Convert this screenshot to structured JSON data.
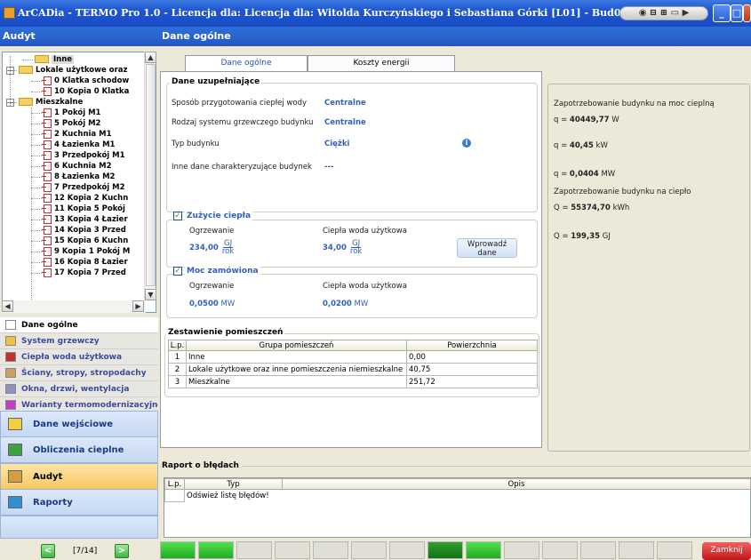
{
  "window": {
    "title": "ArCADia - TERMO Pro 1.0 - Licencja dla: Licencja dla: Witolda Kurczyńskiego i Sebastiana Górki [L01] - Bud0"
  },
  "left_panel": {
    "header": "Audyt",
    "tree": [
      {
        "label": "Inne",
        "kind": "folder",
        "depth": 1
      },
      {
        "label": "Lokale użytkowe oraz",
        "kind": "folder",
        "depth": 0
      },
      {
        "label": "0 Klatka schodow",
        "kind": "doc",
        "depth": 1
      },
      {
        "label": "10 Kopia 0 Klatka",
        "kind": "doc",
        "depth": 1
      },
      {
        "label": "Mieszkalne",
        "kind": "folder",
        "depth": 0
      },
      {
        "label": "1 Pokój M1",
        "kind": "doc",
        "depth": 1
      },
      {
        "label": "5 Pokój M2",
        "kind": "doc",
        "depth": 1
      },
      {
        "label": "2 Kuchnia M1",
        "kind": "doc",
        "depth": 1
      },
      {
        "label": "4 Łazienka M1",
        "kind": "doc",
        "depth": 1
      },
      {
        "label": "3 Przedpokój M1",
        "kind": "doc",
        "depth": 1
      },
      {
        "label": "6 Kuchnia M2",
        "kind": "doc",
        "depth": 1
      },
      {
        "label": "8 Łazienka M2",
        "kind": "doc",
        "depth": 1
      },
      {
        "label": "7 Przedpokój M2",
        "kind": "doc",
        "depth": 1
      },
      {
        "label": "12 Kopia 2 Kuchn",
        "kind": "doc",
        "depth": 1
      },
      {
        "label": "11 Kopia 5 Pokój",
        "kind": "doc",
        "depth": 1
      },
      {
        "label": "13 Kopia 4 Łazier",
        "kind": "doc",
        "depth": 1
      },
      {
        "label": "14 Kopia 3 Przed",
        "kind": "doc",
        "depth": 1
      },
      {
        "label": "15 Kopia 6 Kuchn",
        "kind": "doc",
        "depth": 1
      },
      {
        "label": "9 Kopia 1 Pokój M",
        "kind": "doc",
        "depth": 1
      },
      {
        "label": "16 Kopia 8 Łazier",
        "kind": "doc",
        "depth": 1
      },
      {
        "label": "17 Kopia 7 Przed",
        "kind": "doc",
        "depth": 1
      }
    ],
    "modules": [
      {
        "label": "Dane ogólne",
        "color": "#ffffff"
      },
      {
        "label": "System grzewczy",
        "color": "#e8e6e0"
      },
      {
        "label": "Ciepła woda użytkowa",
        "color": "#e8e6e0"
      },
      {
        "label": "Ściany, stropy, stropodachy",
        "color": "#e8e6e0"
      },
      {
        "label": "Okna, drzwi, wentylacja",
        "color": "#e8e6e0"
      },
      {
        "label": "Warianty termomodernizacyjne",
        "color": "#e8e6e0"
      }
    ],
    "sections": [
      {
        "label": "Dane wejściowe",
        "active": false
      },
      {
        "label": "Obliczenia cieplne",
        "active": false
      },
      {
        "label": "Audyt",
        "active": true
      },
      {
        "label": "Raporty",
        "active": false
      }
    ],
    "pager": "[7/14]"
  },
  "main": {
    "header": "Dane ogólne",
    "tabs": [
      {
        "label": "Dane ogólne",
        "active": true
      },
      {
        "label": "Koszty energii",
        "active": false
      }
    ],
    "uzupelniajace": {
      "title": "Dane uzupełniające",
      "rows": [
        {
          "label": "Sposób przygotowania ciepłej wody",
          "value": "Centralne"
        },
        {
          "label": "Rodzaj systemu grzewczego budynku",
          "value": "Centralne"
        },
        {
          "label": "Typ budynku",
          "value": "Ciężki"
        },
        {
          "label": "Inne dane charakteryzujące budynek",
          "value": "---"
        }
      ]
    },
    "zuzycie": {
      "title": "Zużycie ciepła",
      "checked": true,
      "ogrzewanie_label": "Ogrzewanie",
      "cwu_label": "Ciepła woda użytkowa",
      "ogrzewanie_value": "234,00",
      "cwu_value": "34,00",
      "unit_top": "GJ",
      "unit_bottom": "rok",
      "button": "Wprowadź dane"
    },
    "moc": {
      "title": "Moc zamówiona",
      "checked": true,
      "ogrzewanie_label": "Ogrzewanie",
      "cwu_label": "Ciepła woda użytkowa",
      "ogrzewanie_value": "0,0500",
      "ogrzewanie_unit": "MW",
      "cwu_value": "0,0200",
      "cwu_unit": "MW"
    },
    "zestawienie": {
      "title": "Zestawienie pomieszczeń",
      "columns": [
        "L.p.",
        "Grupa pomieszczeń",
        "Powierzchnia"
      ],
      "rows": [
        [
          "1",
          "Inne",
          "0,00"
        ],
        [
          "2",
          "Lokale użytkowe oraz inne pomieszczenia niemieszkalne",
          "40,75"
        ],
        [
          "3",
          "Mieszkalne",
          "251,72"
        ]
      ]
    },
    "side": {
      "moc_title": "Zapotrzebowanie budynku na moc cieplną",
      "q1_prefix": "q = ",
      "q1_value": "40449,77",
      "q1_unit": "W",
      "q2_prefix": "q = ",
      "q2_value": "40,45",
      "q2_unit": "kW",
      "q3_prefix": "q = ",
      "q3_value": "0,0404",
      "q3_unit": "MW",
      "cieplo_title": "Zapotrzebowanie budynku na ciepło",
      "Q1_prefix": "Q = ",
      "Q1_value": "55374,70",
      "Q1_unit": "kWh",
      "Q2_prefix": "Q = ",
      "Q2_value": "199,35",
      "Q2_unit": "GJ"
    }
  },
  "raport": {
    "title": "Raport o błędach",
    "columns": [
      "L.p.",
      "Typ",
      "Opis"
    ],
    "first_row": "Odśwież listę błędów!"
  },
  "status": {
    "close_button": "Zamknij"
  }
}
